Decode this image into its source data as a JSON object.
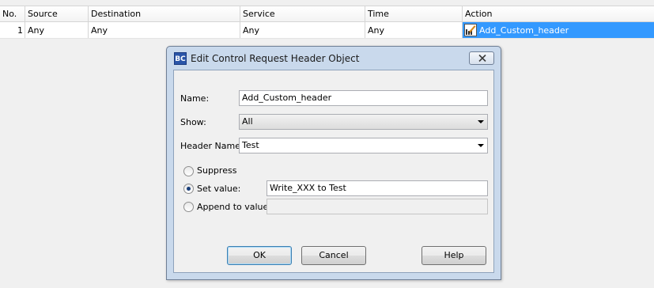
{
  "table": {
    "headers": {
      "no": "No.",
      "source": "Source",
      "destination": "Destination",
      "service": "Service",
      "time": "Time",
      "action": "Action"
    },
    "rows": [
      {
        "no": "1",
        "source": "Any",
        "destination": "Any",
        "service": "Any",
        "time": "Any",
        "action": "Add_Custom_header",
        "action_icon": "edit-header-icon",
        "selected_cell": "action"
      }
    ],
    "selection_color": "#3399ff"
  },
  "dialog": {
    "app_icon_text": "BC",
    "title": "Edit Control Request Header Object",
    "name_label": "Name:",
    "name_value": "Add_Custom_header",
    "show_label": "Show:",
    "show_value": "All",
    "header_name_label": "Header Name:",
    "header_name_value": "Test",
    "options": {
      "suppress_label": "Suppress",
      "set_value_label": "Set value:",
      "set_value_value": "Write_XXX to Test",
      "append_label": "Append to value:",
      "append_value": "",
      "selected": "set_value"
    },
    "buttons": {
      "ok": "OK",
      "cancel": "Cancel",
      "help": "Help"
    }
  }
}
